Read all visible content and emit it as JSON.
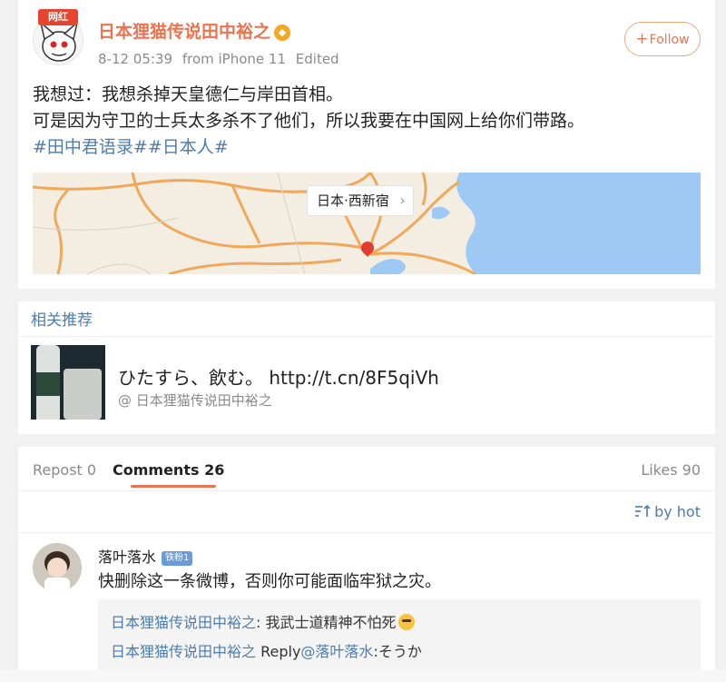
{
  "post": {
    "avatar_badge": "网红",
    "username": "日本狸猫传说田中裕之",
    "timestamp": "8-12 05:39",
    "source": "from iPhone 11",
    "edited": "Edited",
    "follow_label": "Follow",
    "text_line1": "我想过：我想杀掉天皇德仁与岸田首相。",
    "text_line2": "可是因为守卫的士兵太多杀不了他们，所以我要在中国网上给你们带路。",
    "hashtags": "#田中君语录##日本人#",
    "location": "日本·西新宿",
    "location_chevron": "›"
  },
  "recommend": {
    "title": "相关推荐",
    "text": "ひたすら、飲む。 http://t.cn/8F5qiVh",
    "author": "@ 日本狸猫传说田中裕之"
  },
  "comments_section": {
    "tabs": {
      "repost_label": "Repost",
      "repost_count": "0",
      "comments_label": "Comments",
      "comments_count": "26",
      "likes_label": "Likes",
      "likes_count": "90"
    },
    "sort_label": "by hot",
    "comment": {
      "user": "落叶落水",
      "badge": "铁粉1",
      "text": "快删除这一条微博，否则你可能面临牢狱之灾。",
      "replies": [
        {
          "name": "日本狸猫传说田中裕之",
          "separator": ": ",
          "text": "我武士道精神不怕死"
        },
        {
          "name": "日本狸猫传说田中裕之",
          "reply_word": " Reply",
          "mention": "@落叶落水",
          "text": ":そうか"
        }
      ]
    }
  },
  "colors": {
    "accent": "#eb7350",
    "link": "#4d7cae",
    "map_water": "#9ec9f4",
    "map_road": "#f0a95a"
  },
  "icons": [
    "plus-icon",
    "vip-icon",
    "chevron-right-icon",
    "map-pin-icon",
    "sort-icon",
    "emoji-icon"
  ]
}
